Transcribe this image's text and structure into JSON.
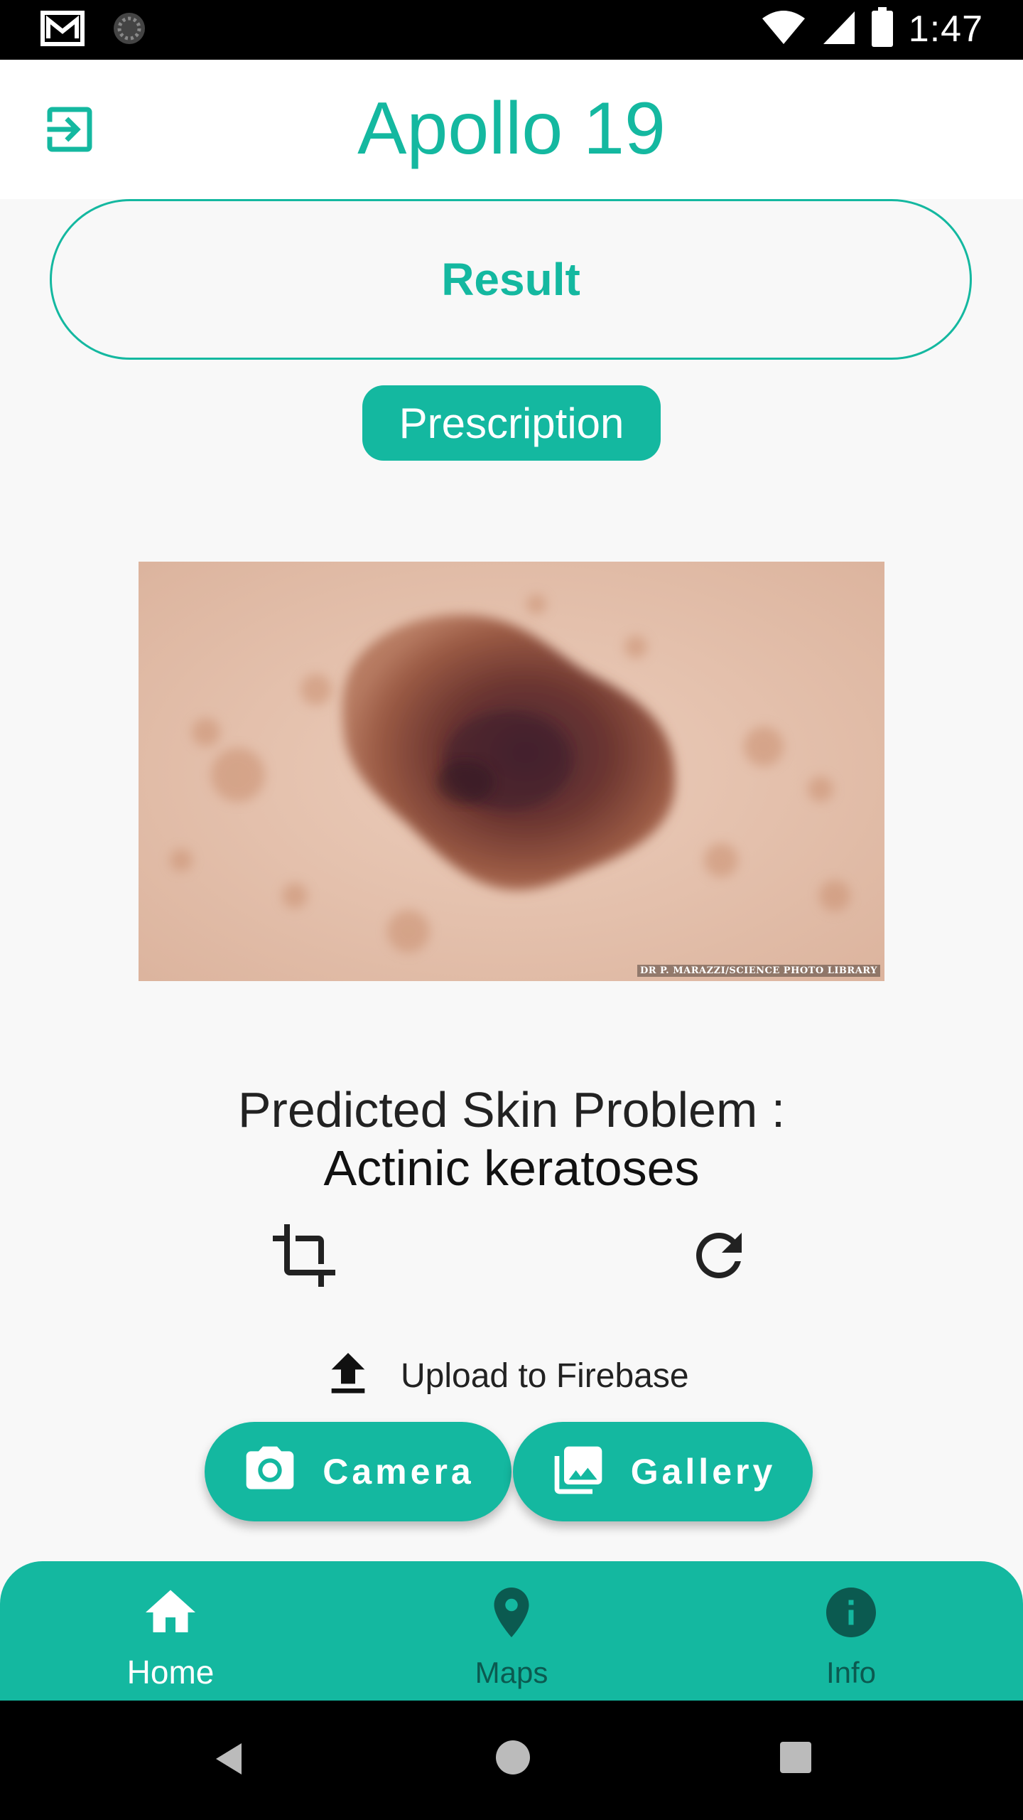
{
  "status_bar": {
    "time": "1:47",
    "icons": [
      "gmail-icon",
      "sync-icon",
      "wifi-icon",
      "signal-icon",
      "battery-icon"
    ]
  },
  "app_bar": {
    "title": "Apollo 19",
    "exit_icon": "exit-to-app-icon"
  },
  "result": {
    "label": "Result"
  },
  "prescription": {
    "label": "Prescription"
  },
  "photo": {
    "credit": "DR P. MARAZZI/SCIENCE PHOTO LIBRARY"
  },
  "prediction": {
    "heading": "Predicted Skin Problem :",
    "value": "Actinic keratoses"
  },
  "tools": {
    "crop_icon": "crop-icon",
    "rotate_icon": "rotate-icon"
  },
  "upload": {
    "label": "Upload to Firebase"
  },
  "actions": {
    "camera_label": "Camera",
    "gallery_label": "Gallery"
  },
  "bottom_nav": {
    "items": [
      {
        "label": "Home",
        "icon": "home-icon",
        "active": true
      },
      {
        "label": "Maps",
        "icon": "map-pin-icon",
        "active": false
      },
      {
        "label": "Info",
        "icon": "info-icon",
        "active": false
      }
    ]
  },
  "colors": {
    "accent": "#14b8a0",
    "inactive_nav": "#0b5a50",
    "background": "#f8f8f8"
  }
}
